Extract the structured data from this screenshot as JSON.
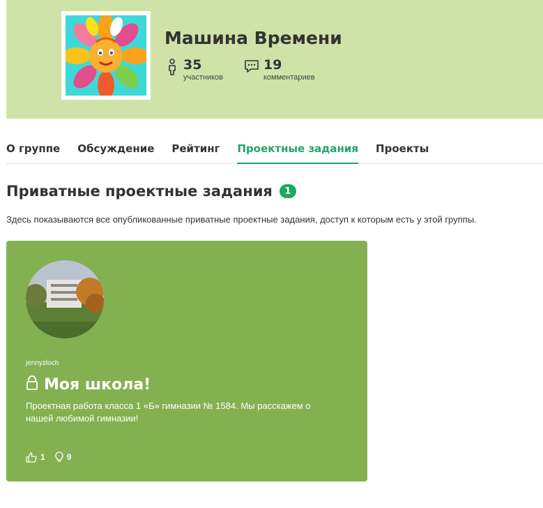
{
  "group": {
    "title": "Машина Времени",
    "members_count": "35",
    "members_label": "участников",
    "comments_count": "19",
    "comments_label": "комментариев"
  },
  "tabs": [
    {
      "label": "О группе",
      "active": false
    },
    {
      "label": "Обсуждение",
      "active": false
    },
    {
      "label": "Рейтинг",
      "active": false
    },
    {
      "label": "Проектные задания",
      "active": true
    },
    {
      "label": "Проекты",
      "active": false
    }
  ],
  "section": {
    "title": "Приватные проектные задания",
    "count": "1",
    "description": "Здесь показываются все опубликованные приватные проектные задания, доступ к которым есть у этой группы."
  },
  "card": {
    "author": "jennyzloch",
    "title": "Моя школа!",
    "description": "Проектная работа класса 1 «Б» гимназии № 1584. Мы расскажем о нашей любимой гимназии!",
    "likes": "1",
    "ideas": "9"
  },
  "colors": {
    "header_bg": "#cfe3a8",
    "accent": "#23a46b",
    "card_bg": "#83b151",
    "badge_bg": "#1fa85f"
  },
  "icons": {
    "members": "person-icon",
    "comments": "comment-icon",
    "lock": "lock-icon",
    "like": "thumbs-up-icon",
    "idea": "lightbulb-icon"
  }
}
